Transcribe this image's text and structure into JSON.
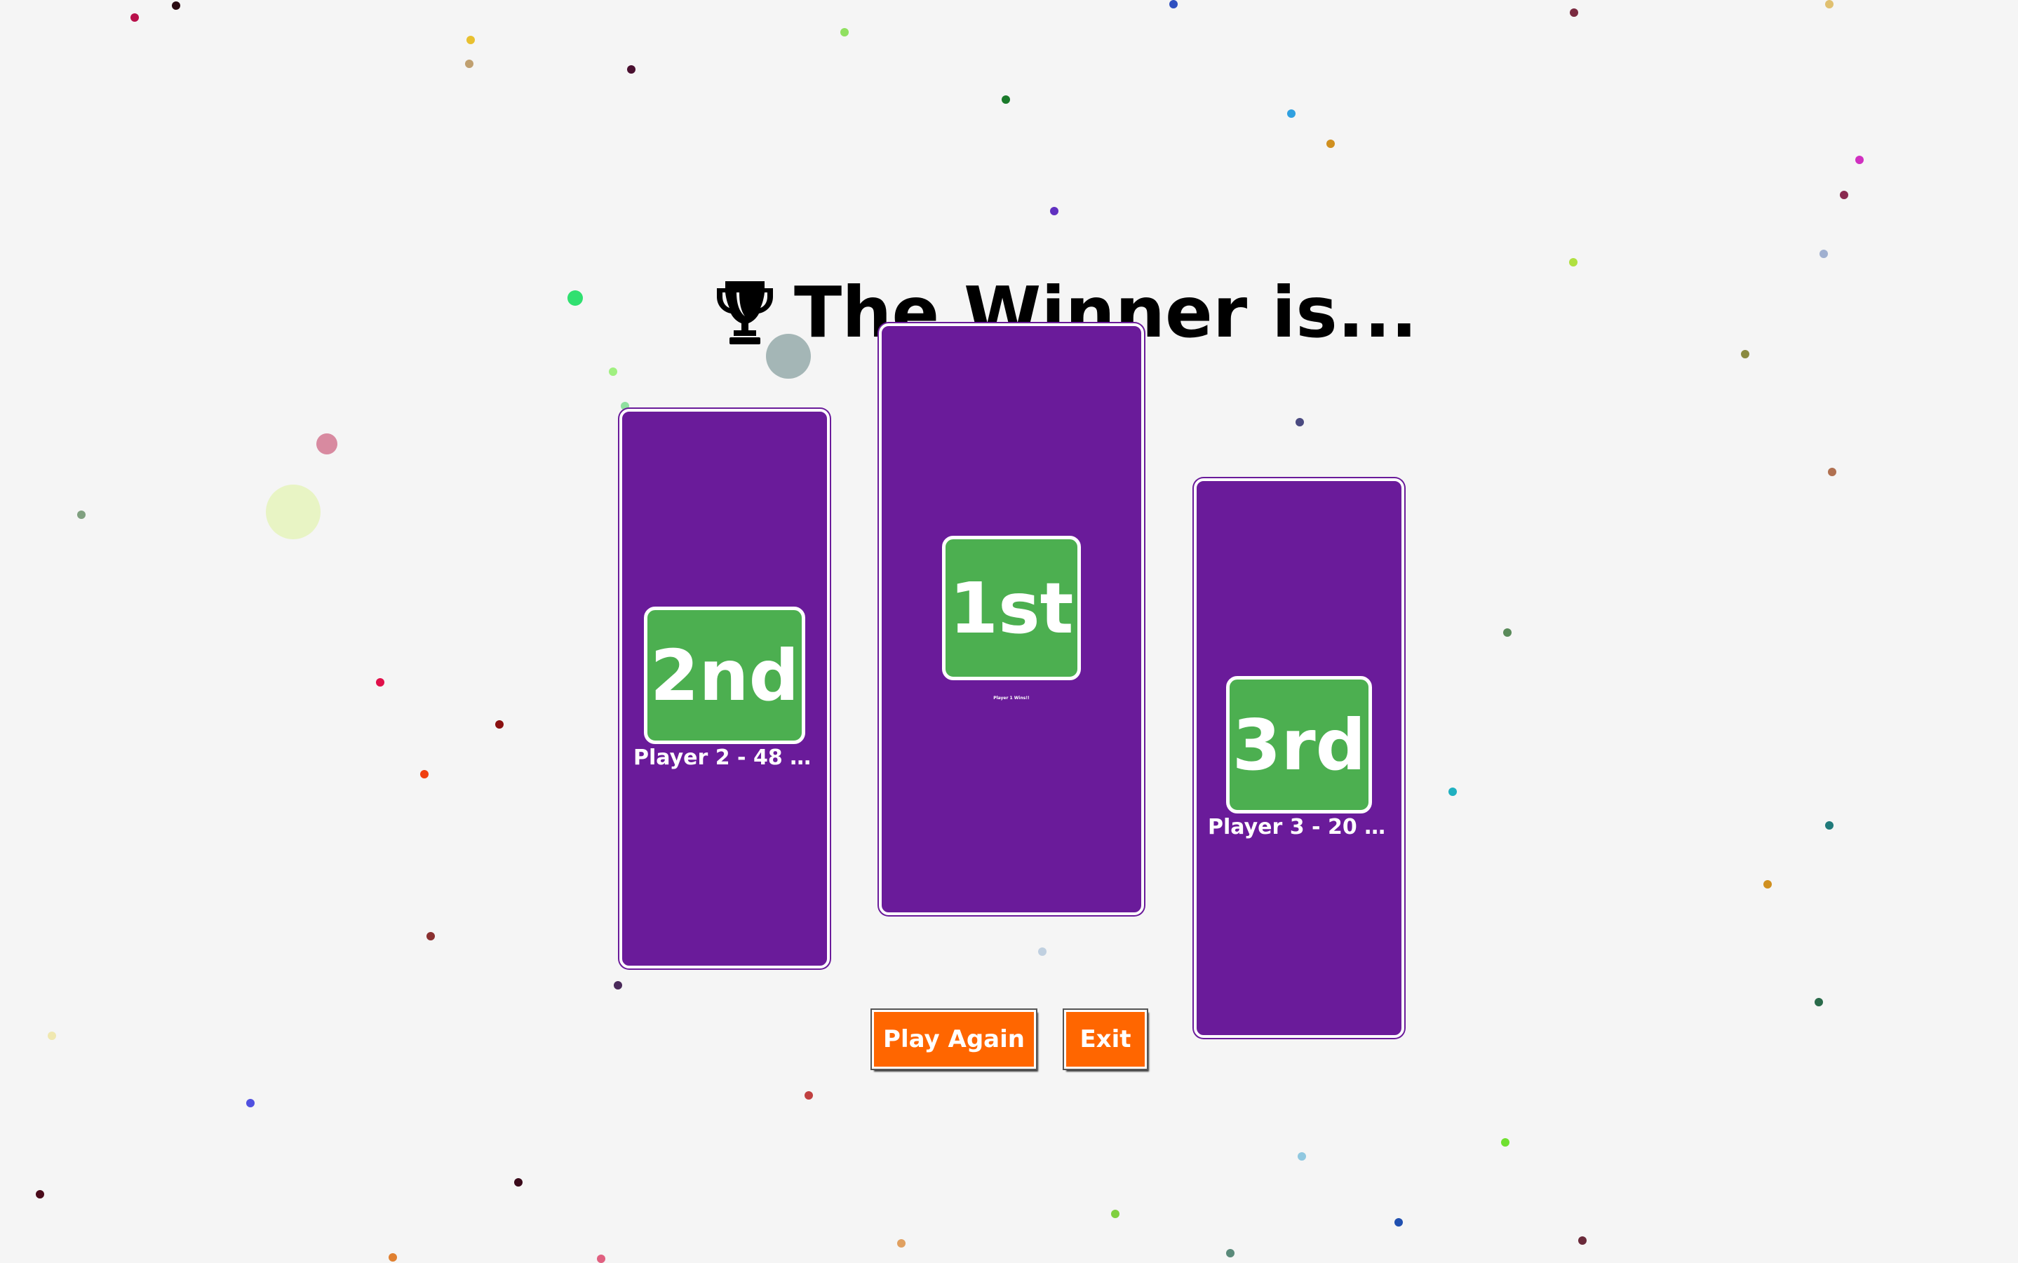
{
  "title": {
    "text": "The Winner is...",
    "icon": "trophy-icon"
  },
  "podiums": {
    "first": {
      "rank_label": "1st",
      "player_text": "Player 1 Wins!!"
    },
    "second": {
      "rank_label": "2nd",
      "player_text": "Player 2 - 48 p..."
    },
    "third": {
      "rank_label": "3rd",
      "player_text": "Player 3 - 20 p..."
    }
  },
  "buttons": {
    "play_again": "Play Again",
    "exit": "Exit"
  },
  "colors": {
    "background": "#f5f5f5",
    "podium": "#6a1b9a",
    "badge": "#4caf50",
    "button": "#ff6600",
    "text": "#ffffff"
  }
}
